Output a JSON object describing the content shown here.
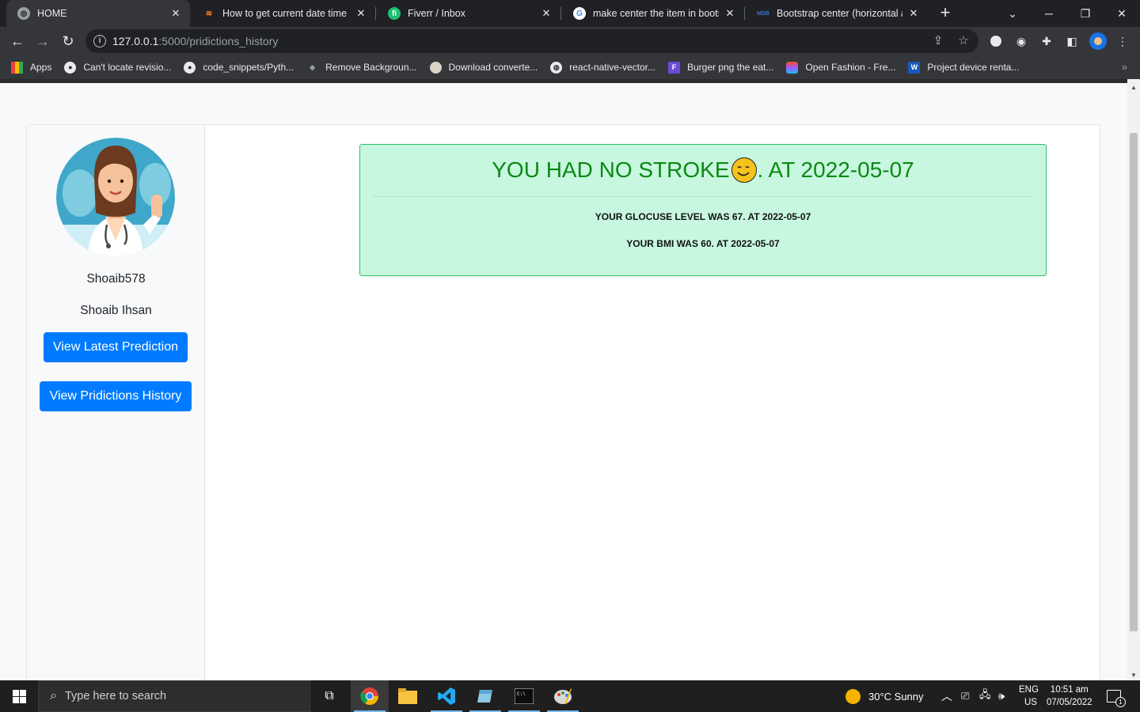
{
  "browser": {
    "tabs": [
      {
        "title": "HOME",
        "favicon": "globe-icon",
        "active": true
      },
      {
        "title": "How to get current date time in",
        "favicon": "stackoverflow-icon",
        "active": false
      },
      {
        "title": "Fiverr / Inbox",
        "favicon": "fiverr-icon",
        "active": false
      },
      {
        "title": "make center the item in bootstr",
        "favicon": "google-icon",
        "active": false
      },
      {
        "title": "Bootstrap center (horizontal alig",
        "favicon": "mdb-icon",
        "active": false
      }
    ],
    "url_host": "127.0.0.1",
    "url_path": ":5000/pridictions_history",
    "bookmarks": [
      {
        "label": "Apps",
        "icon": "apps-grid-icon"
      },
      {
        "label": "Can't locate revisio...",
        "icon": "github-icon"
      },
      {
        "label": "code_snippets/Pyth...",
        "icon": "github-icon"
      },
      {
        "label": "Remove Backgroun...",
        "icon": "layers-icon"
      },
      {
        "label": "Download converte...",
        "icon": "circle-icon"
      },
      {
        "label": "react-native-vector...",
        "icon": "globe-icon"
      },
      {
        "label": "Burger png the eat...",
        "icon": "f-logo-icon"
      },
      {
        "label": "Open Fashion - Fre...",
        "icon": "figma-icon"
      },
      {
        "label": "Project device renta...",
        "icon": "word-icon"
      }
    ]
  },
  "profile": {
    "username": "Shoaib578",
    "full_name": "Shoaib Ihsan",
    "btn_latest": "View Latest Prediction",
    "btn_history": "View Pridictions History"
  },
  "result": {
    "heading_left": "YOU HAD NO STROKE",
    "heading_right": ". AT 2022-05-07",
    "glucose_line": "YOUR GLOCUSE LEVEL WAS 67. AT 2022-05-07",
    "bmi_line": "YOUR BMI WAS 60. AT 2022-05-07"
  },
  "taskbar": {
    "search_placeholder": "Type here to search",
    "weather": "30°C  Sunny",
    "lang_top": "ENG",
    "lang_bottom": "US",
    "time": "10:51 am",
    "date": "07/05/2022",
    "notifications": "1"
  },
  "colors": {
    "primary": "#007bff",
    "success_bg": "#c8f7e0",
    "success_text": "#0b8a12"
  }
}
